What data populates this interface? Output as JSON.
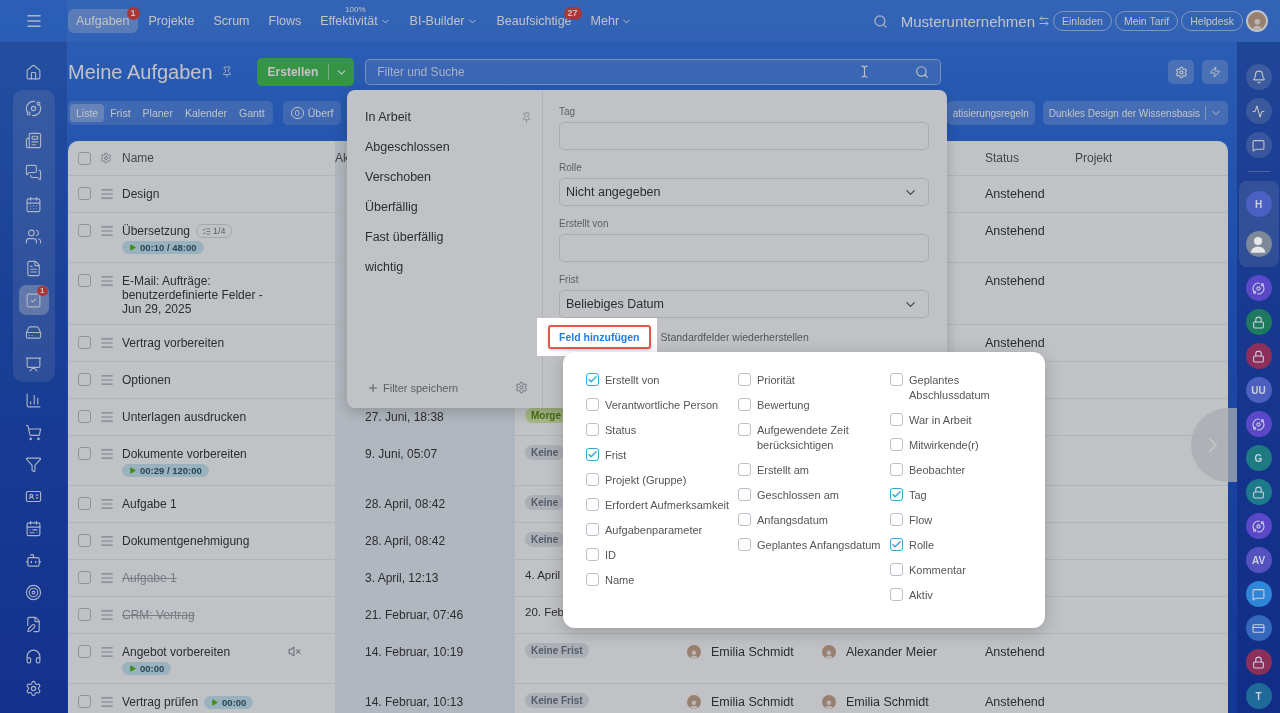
{
  "topbar": {
    "tabs": [
      {
        "label": "Aufgaben",
        "selected": true,
        "badge": "1"
      },
      {
        "label": "Projekte",
        "selected": false
      },
      {
        "label": "Scrum",
        "selected": false
      },
      {
        "label": "Flows",
        "selected": false
      },
      {
        "label": "Effektivität",
        "selected": false,
        "dropdown": true,
        "superscript": "100%"
      },
      {
        "label": "BI-Builder",
        "selected": false,
        "dropdown": true
      },
      {
        "label": "Beaufsichtige",
        "selected": false,
        "badge": "27"
      },
      {
        "label": "Mehr",
        "selected": false,
        "dropdown": true
      }
    ],
    "company": "Musterunternehmen",
    "buttons": [
      "Einladen",
      "Mein Tarif",
      "Helpdesk"
    ]
  },
  "left_sidebar": {
    "items": [
      {
        "selected": false,
        "grouped": false
      },
      {
        "selected": false,
        "grouped": true
      },
      {
        "selected": false,
        "grouped": true
      },
      {
        "selected": false,
        "grouped": true
      },
      {
        "selected": false,
        "grouped": true
      },
      {
        "selected": false,
        "grouped": true
      },
      {
        "selected": false,
        "grouped": true
      },
      {
        "selected": true,
        "grouped": true,
        "badge": "1"
      },
      {
        "selected": false,
        "grouped": true
      },
      {
        "selected": false,
        "grouped": true
      },
      {
        "selected": false,
        "grouped": false
      },
      {
        "selected": false,
        "grouped": false
      },
      {
        "selected": false,
        "grouped": false
      },
      {
        "selected": false,
        "grouped": false
      },
      {
        "selected": false,
        "grouped": false
      },
      {
        "selected": false,
        "grouped": false
      },
      {
        "selected": false,
        "grouped": false
      },
      {
        "selected": false,
        "grouped": false
      },
      {
        "selected": false,
        "grouped": false
      },
      {
        "selected": false,
        "grouped": false
      }
    ]
  },
  "right_sidebar": {
    "tools": [
      {
        "kind": "bell"
      },
      {
        "kind": "activity"
      },
      {
        "kind": "chat"
      }
    ],
    "pinned": [
      {
        "kind": "letter",
        "label": "H",
        "color": "#4c5fc2"
      },
      {
        "kind": "person",
        "color": "#7d8898"
      }
    ],
    "contacts": [
      {
        "kind": "spiral",
        "color": "#5a48c8"
      },
      {
        "kind": "lock",
        "color": "#1e7a5e"
      },
      {
        "kind": "lock",
        "color": "#8c2f5a"
      },
      {
        "kind": "letter",
        "label": "UU",
        "color": "#4c5fbe"
      },
      {
        "kind": "spiral",
        "color": "#5a48c8"
      },
      {
        "kind": "letter",
        "label": "G",
        "color": "#1d7a80"
      },
      {
        "kind": "lock",
        "color": "#1d7a8a"
      },
      {
        "kind": "spiral",
        "color": "#5a48c8"
      },
      {
        "kind": "letter",
        "label": "AV",
        "color": "#5552c0"
      },
      {
        "kind": "chat",
        "color": "#2f86d8"
      },
      {
        "kind": "card",
        "color": "#3468bc"
      },
      {
        "kind": "lock",
        "color": "#8c2f5a"
      },
      {
        "kind": "letter",
        "label": "T",
        "color": "#1f6a98"
      }
    ]
  },
  "page": {
    "title": "Meine Aufgaben",
    "create_button": "Erstellen",
    "search": {
      "placeholder": "Filter und Suche"
    }
  },
  "view_tabs": [
    {
      "label": "Liste",
      "selected": true
    },
    {
      "label": "Frist",
      "selected": false
    },
    {
      "label": "Planer",
      "selected": false
    },
    {
      "label": "Kalender",
      "selected": false
    },
    {
      "label": "Gantt",
      "selected": false
    }
  ],
  "counter": {
    "count": "0",
    "label": "Überf"
  },
  "toolbar_buttons": [
    {
      "label": "atisierungsregeln",
      "dropdown": false
    },
    {
      "label": "Dunkles Design der Wissensbasis",
      "dropdown": true
    }
  ],
  "table": {
    "all_checked": false,
    "columns": [
      {
        "kind": "name",
        "label": "Name"
      },
      {
        "kind": "activity",
        "label": "Ak"
      },
      {
        "kind": "status",
        "label": "Status"
      },
      {
        "kind": "project",
        "label": "Projekt"
      }
    ],
    "rows": [
      {
        "checked": false,
        "name": "Design",
        "done": false,
        "status": "Anstehend"
      },
      {
        "checked": false,
        "name": "Übersetzung",
        "done": false,
        "checklist": "1/4",
        "timer": "00:10 / 48:00",
        "status": "Anstehend"
      },
      {
        "checked": false,
        "name": "E-Mail: Aufträge: benutzerdefinierte Felder - Jun 29, 2025",
        "done": false,
        "status": "Anstehend"
      },
      {
        "checked": false,
        "name": "Vertrag vorbereiten",
        "done": false,
        "status": "Anstehend"
      },
      {
        "checked": false,
        "name": "Optionen",
        "done": false
      },
      {
        "checked": false,
        "name": "Unterlagen ausdrucken",
        "done": false,
        "date": "27. Juni, 18:38",
        "deadline": {
          "text": "Morge",
          "kind": "soon"
        }
      },
      {
        "checked": false,
        "name": "Dokumente vorbereiten",
        "done": false,
        "timer": "00:29 / 120:00",
        "date": "9. Juni, 05:07",
        "deadline": {
          "text": "Keine",
          "kind": "none"
        }
      },
      {
        "checked": false,
        "name": "Aufgabe 1",
        "done": false,
        "date": "28. April, 08:42",
        "deadline": {
          "text": "Keine",
          "kind": "none"
        }
      },
      {
        "checked": false,
        "name": "Dokumentgenehmigung",
        "done": false,
        "date": "28. April, 08:42",
        "deadline": {
          "text": "Keine",
          "kind": "none"
        }
      },
      {
        "checked": false,
        "name": "Aufgabe 1",
        "done": true,
        "date": "3. April, 12:13",
        "deadline": {
          "text": "4. April",
          "kind": "date"
        }
      },
      {
        "checked": false,
        "name": "CRM: Vertrag",
        "done": true,
        "date": "21. Februar, 07:46",
        "deadline": {
          "text": "20. Feb",
          "kind": "date"
        }
      },
      {
        "checked": false,
        "name": "Angebot vorbereiten",
        "done": false,
        "muted": true,
        "timer": "00:00",
        "date": "14. Februar, 10:19",
        "deadline": {
          "text": "Keine Frist",
          "kind": "none"
        },
        "responsible": "Emilia Schmidt",
        "creator": "Alexander Meier",
        "status": "Anstehend"
      },
      {
        "checked": false,
        "name": "Vertrag prüfen",
        "done": false,
        "inline_timer": "00:00",
        "date": "14. Februar, 10:13",
        "deadline": {
          "text": "Keine Frist",
          "kind": "none"
        },
        "responsible": "Emilia Schmidt",
        "creator": "Emilia Schmidt",
        "status": "Anstehend"
      }
    ]
  },
  "filter_panel": {
    "presets": [
      {
        "label": "In Arbeit",
        "pinned": true
      },
      {
        "label": "Abgeschlossen",
        "pinned": false
      },
      {
        "label": "Verschoben",
        "pinned": false
      },
      {
        "label": "Überfällig",
        "pinned": false
      },
      {
        "label": "Fast überfällig",
        "pinned": false
      },
      {
        "label": "wichtig",
        "pinned": false
      }
    ],
    "save_label": "Filter speichern",
    "fields": [
      {
        "label": "Tag",
        "kind": "input"
      },
      {
        "label": "Rolle",
        "kind": "select",
        "value": "Nicht angegeben"
      },
      {
        "label": "Erstellt von",
        "kind": "input"
      },
      {
        "label": "Frist",
        "kind": "select",
        "value": "Beliebiges Datum"
      }
    ],
    "add_field": "Feld hinzufügen",
    "restore": "Standardfelder wiederherstellen"
  },
  "field_picker": {
    "columns": [
      {
        "items": [
          {
            "label": "Erstellt von",
            "checked": true
          },
          {
            "label": "Verantwortliche Person",
            "checked": false
          },
          {
            "label": "Status",
            "checked": false
          },
          {
            "label": "Frist",
            "checked": true
          },
          {
            "label": "Projekt (Gruppe)",
            "checked": false
          },
          {
            "label": "Erfordert Aufmerksamkeit",
            "checked": false
          },
          {
            "label": "Aufgabenparameter",
            "checked": false
          },
          {
            "label": "ID",
            "checked": false
          },
          {
            "label": "Name",
            "checked": false
          }
        ]
      },
      {
        "items": [
          {
            "label": "Priorität",
            "checked": false
          },
          {
            "label": "Bewertung",
            "checked": false
          },
          {
            "label": "Aufgewendete Zeit berücksichtigen",
            "checked": false
          },
          {
            "label": "Erstellt am",
            "checked": false
          },
          {
            "label": "Geschlossen am",
            "checked": false
          },
          {
            "label": "Anfangsdatum",
            "checked": false
          },
          {
            "label": "Geplantes Anfangsdatum",
            "checked": false
          }
        ]
      },
      {
        "items": [
          {
            "label": "Geplantes Abschlussdatum",
            "checked": false
          },
          {
            "label": "War in Arbeit",
            "checked": false
          },
          {
            "label": "Mitwirkende(r)",
            "checked": false
          },
          {
            "label": "Beobachter",
            "checked": false
          },
          {
            "label": "Tag",
            "checked": true
          },
          {
            "label": "Flow",
            "checked": false
          },
          {
            "label": "Rolle",
            "checked": true
          },
          {
            "label": "Kommentar",
            "checked": false
          },
          {
            "label": "Aktiv",
            "checked": false
          }
        ]
      }
    ]
  }
}
